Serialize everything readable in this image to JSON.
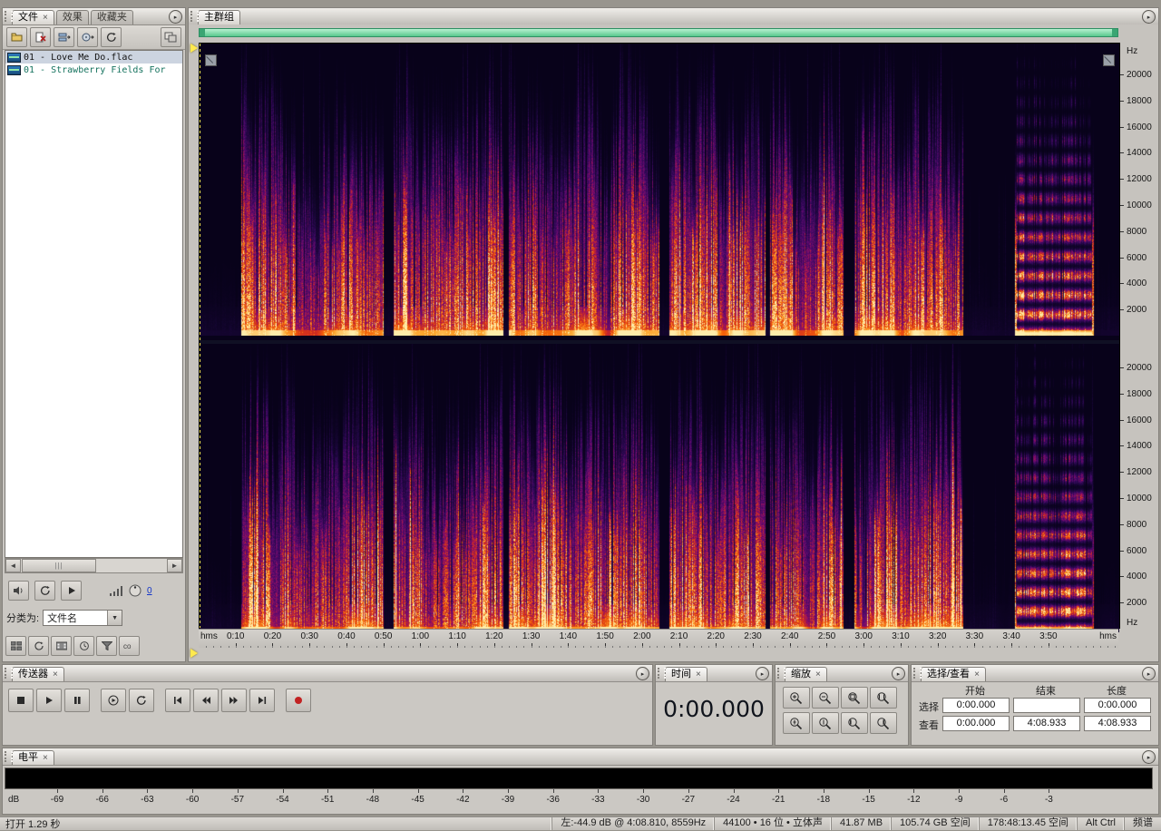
{
  "colors": {
    "accent_green": "#57c98d",
    "playhead_yellow": "#ffe94e",
    "record_red": "#c22222",
    "file_alt_text": "#16735f"
  },
  "files_panel": {
    "tabs": [
      {
        "label": "文件"
      },
      {
        "label": "效果"
      },
      {
        "label": "收藏夹"
      }
    ],
    "files": [
      {
        "name": "01 - Love Me Do.flac",
        "selected": true,
        "color": "#111111"
      },
      {
        "name": "01 - Strawberry Fields For",
        "selected": false,
        "color": "#16735f"
      }
    ],
    "scroll_grip": "⫼",
    "sort_label": "分类为:",
    "sort_value": "文件名",
    "preview_volume": "0"
  },
  "main_panel": {
    "tab": "主群组",
    "freq_unit": "Hz",
    "freq_ticks": [
      20000,
      18000,
      16000,
      14000,
      12000,
      10000,
      8000,
      6000,
      4000,
      2000
    ],
    "time_unit": "hms",
    "time_ticks": [
      "0:10",
      "0:20",
      "0:30",
      "0:40",
      "0:50",
      "1:00",
      "1:10",
      "1:20",
      "1:30",
      "1:40",
      "1:50",
      "2:00",
      "2:10",
      "2:20",
      "2:30",
      "2:40",
      "2:50",
      "3:00",
      "3:10",
      "3:20",
      "3:30",
      "3:40",
      "3:50"
    ],
    "duration_sec": 248.933
  },
  "transport_panel": {
    "title": "传送器"
  },
  "time_panel": {
    "title": "时间",
    "value": "0:00.000"
  },
  "zoom_panel": {
    "title": "缩放"
  },
  "selection_panel": {
    "title": "选择/查看",
    "col_headers": [
      "开始",
      "结束",
      "长度"
    ],
    "rows": [
      {
        "label": "选择",
        "start": "0:00.000",
        "end": "",
        "length": "0:00.000"
      },
      {
        "label": "查看",
        "start": "0:00.000",
        "end": "4:08.933",
        "length": "4:08.933"
      }
    ]
  },
  "levels_panel": {
    "title": "电平",
    "unit": "dB",
    "ticks": [
      -69,
      -66,
      -63,
      -60,
      -57,
      -54,
      -51,
      -48,
      -45,
      -42,
      -39,
      -36,
      -33,
      -30,
      -27,
      -24,
      -21,
      -18,
      -15,
      -12,
      -9,
      -6,
      -3
    ]
  },
  "status_bar": {
    "opened": "打开 1.29 秒",
    "cursor_info": "左:-44.9 dB @ 4:08.810, 8559Hz",
    "format": "44100 • 16 位 • 立体声",
    "file_size": "41.87 MB",
    "free_space": "105.74 GB 空间",
    "free_time": "178:48:13.45 空间",
    "modifier_keys": "Alt Ctrl",
    "view_mode": "频谱"
  },
  "spectrogram": {
    "palette": [
      [
        0,
        "#08021a"
      ],
      [
        0.1,
        "#1a063a"
      ],
      [
        0.22,
        "#36085c"
      ],
      [
        0.35,
        "#600a6e"
      ],
      [
        0.48,
        "#961060"
      ],
      [
        0.6,
        "#d02c20"
      ],
      [
        0.72,
        "#f4600a"
      ],
      [
        0.85,
        "#fca42c"
      ],
      [
        1,
        "#ffecaa"
      ]
    ],
    "quiet_regions": [
      [
        0,
        0.045
      ],
      [
        0.2,
        0.211
      ],
      [
        0.33,
        0.336
      ],
      [
        0.5,
        0.51
      ],
      [
        0.615,
        0.62
      ],
      [
        0.7,
        0.712
      ],
      [
        0.83,
        0.886
      ],
      [
        0.972,
        1
      ]
    ],
    "final_burst": [
      0.888,
      0.97
    ],
    "seeds": [
      20210521,
      87650123
    ]
  }
}
